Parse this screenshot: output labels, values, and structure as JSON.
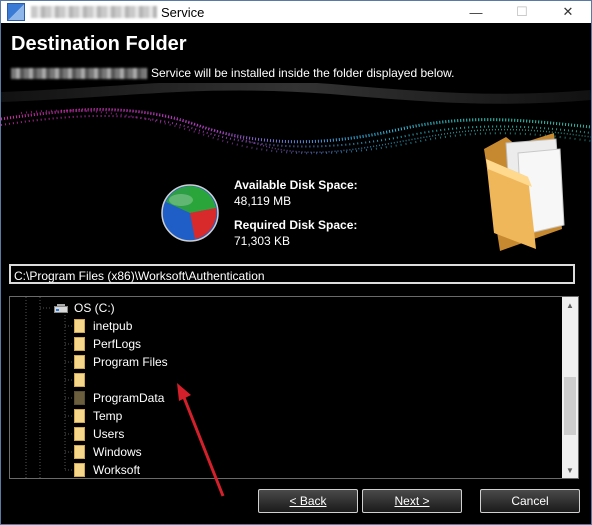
{
  "window": {
    "title_suffix": "Service",
    "controls": {
      "minimize": "—",
      "maximize": "☐",
      "close": "✕"
    }
  },
  "header": {
    "title": "Destination Folder",
    "description": "Service will be installed inside the folder displayed below."
  },
  "disk": {
    "available_label": "Available Disk Space:",
    "available_value": "48,119 MB",
    "required_label": "Required Disk Space:",
    "required_value": "71,303 KB"
  },
  "path": {
    "value": "C:\\Program Files (x86)\\Worksoft\\Authentication"
  },
  "tree": {
    "drive": "OS (C:)",
    "folders": [
      "inetpub",
      "PerfLogs",
      "Program Files",
      "",
      "ProgramData",
      "Temp",
      "Users",
      "Windows",
      "Worksoft"
    ],
    "scroll_up": "▲",
    "scroll_down": "▼"
  },
  "buttons": {
    "back": "< Back",
    "next": "Next >",
    "cancel": "Cancel"
  },
  "colors": {
    "background": "#000000",
    "text": "#ffffff",
    "annotation_arrow": "#d3202a",
    "folder": "#f5d68a"
  },
  "icons": [
    "app-icon",
    "disk-pie-icon",
    "folder-illustration-icon",
    "drive-icon",
    "folder-icon"
  ]
}
